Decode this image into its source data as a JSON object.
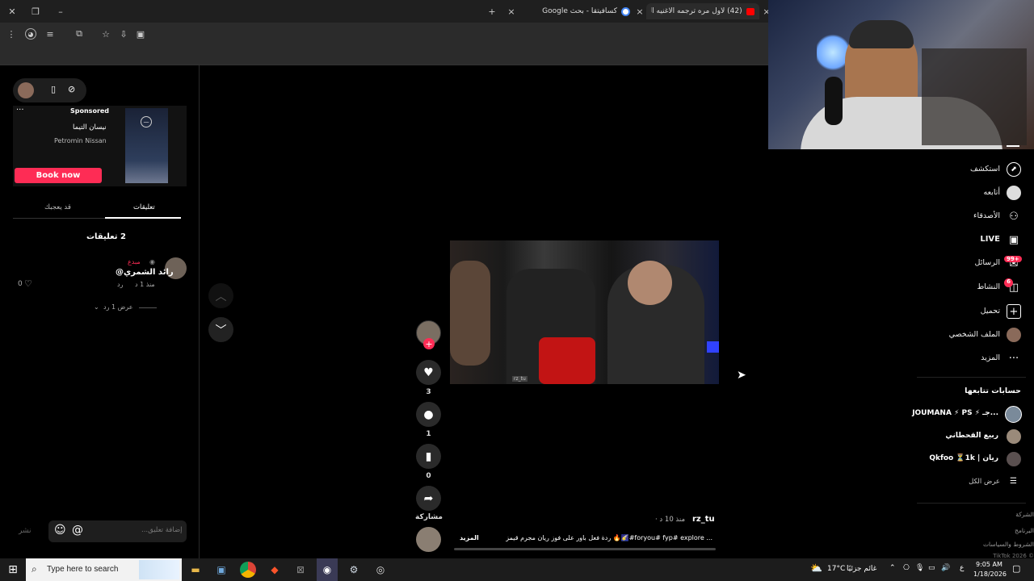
{
  "browser": {
    "tabs": [
      {
        "label": "(42) لاول مره ترجمه الاغنيه العس"
      },
      {
        "label": "كسافيتقا - بحث Google"
      }
    ],
    "new_tab_symbol": "+",
    "close_symbol": "×"
  },
  "left_panel": {
    "ad": {
      "sponsored": "Sponsored",
      "title": "نيسان التيما",
      "advertiser": "Petromin Nissan",
      "cta": "Book now",
      "more": "···"
    },
    "tabs": {
      "comments": "تعليقات",
      "you_may_like": "قد يعجبك"
    },
    "comments_count": "2 تعليقات",
    "comment": {
      "badge": "مبدع",
      "author": "رائد الشمري@",
      "time": "منذ 1 د",
      "reply": "رد",
      "likes": "0",
      "view_replies": "عرض 1 رد"
    },
    "input": {
      "placeholder": "إضافة تعليق...",
      "at": "@",
      "post": "نشر"
    }
  },
  "video": {
    "watermark": "rz_tu",
    "author": "rz_tu",
    "time": "منذ 10 د ·",
    "caption": "... foryou# fyp# explore#🌠🔥 ردة فعل باور على فوز ريان مجرم قيمز",
    "more": "المزيد",
    "actions": {
      "likes": "3",
      "comments": "1",
      "saves": "0",
      "share": "مشاركة"
    }
  },
  "right_nav": {
    "items": [
      {
        "label": "استكشف",
        "icon": "compass-icon"
      },
      {
        "label": "أتابعه",
        "icon": "avatar-icon"
      },
      {
        "label": "الأصدقاء",
        "icon": "friends-icon"
      },
      {
        "label": "LIVE",
        "icon": "live-icon"
      },
      {
        "label": "الرسائل",
        "icon": "messages-icon",
        "badge": "99+"
      },
      {
        "label": "النشاط",
        "icon": "activity-icon",
        "badge": "6"
      },
      {
        "label": "تحميل",
        "icon": "upload-icon"
      },
      {
        "label": "الملف الشخصي",
        "icon": "profile-icon"
      },
      {
        "label": "المزيد",
        "icon": "more-icon"
      }
    ],
    "following_title": "حسابات تتابعها",
    "following": [
      {
        "name": "JOUMANA ⚡ PS ⚡ جـ..."
      },
      {
        "name": "ربيع القحطاني"
      },
      {
        "name": "Qkfoo ⏳1k | ريان"
      }
    ],
    "see_all": "عرض الكل",
    "footer": [
      "الشركة",
      "البرنامج",
      "الشروط والسياسات",
      "TikTok 2026 ©"
    ]
  },
  "taskbar": {
    "search_placeholder": "Type here to search",
    "weather_temp": "17°C",
    "weather_text": "غائم جزئيًا",
    "lang": "ع",
    "time": "9:05 AM",
    "date": "1/18/2026"
  },
  "colors": {
    "accent": "#fe2c55",
    "panel": "#121212",
    "taskbar": "#1c1c1c"
  }
}
